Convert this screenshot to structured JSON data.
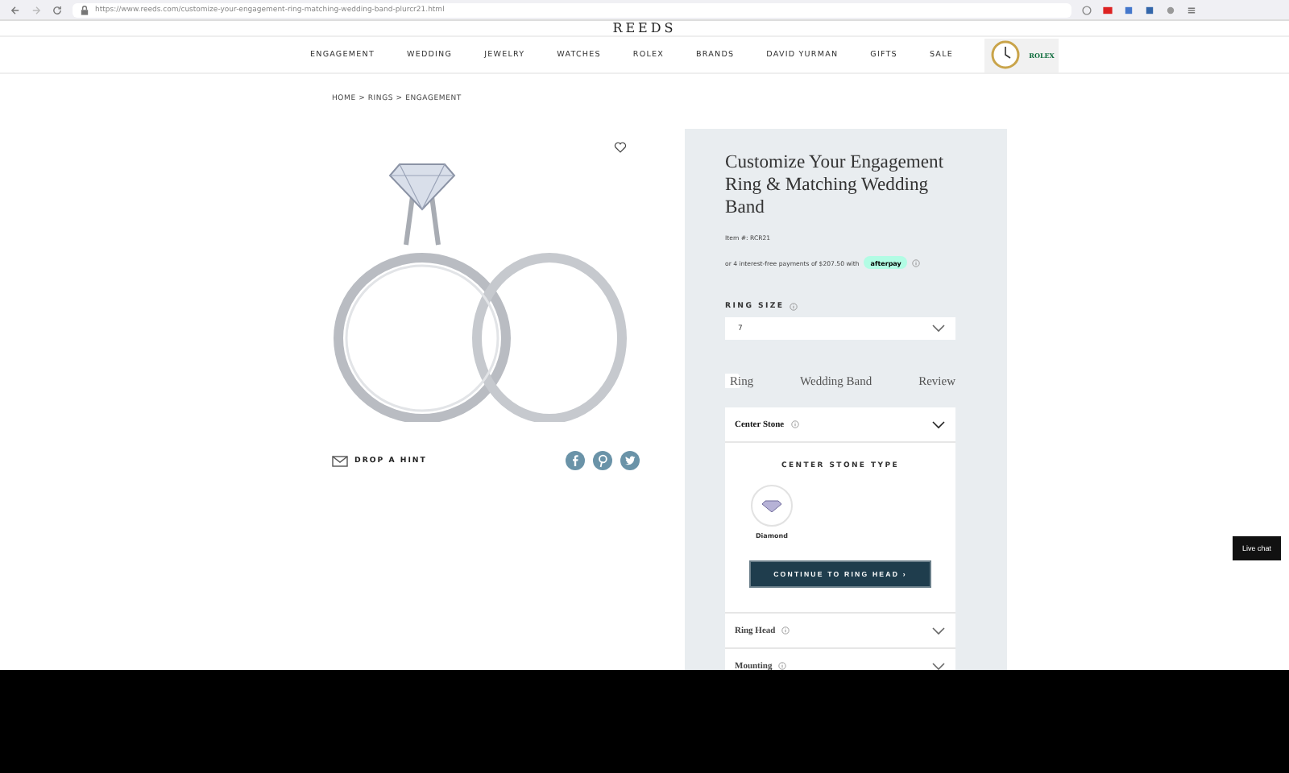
{
  "browser": {
    "url": "https://www.reeds.com/customize-your-engagement-ring-matching-wedding-band-plurcr21.html"
  },
  "logo": "REEDS",
  "nav": [
    "ENGAGEMENT",
    "WEDDING",
    "JEWELRY",
    "WATCHES",
    "ROLEX",
    "BRANDS",
    "DAVID YURMAN",
    "GIFTS",
    "SALE"
  ],
  "rolex_badge": {
    "label": "ROLEX"
  },
  "breadcrumb": "HOME > RINGS > ENGAGEMENT",
  "drop_hint": "DROP A HINT",
  "product": {
    "title": "Customize Your Engagement Ring & Matching Wedding Band",
    "item_number": "Item #: RCR21",
    "afterpay_text": "or 4 interest-free payments of $207.50 with",
    "afterpay_badge": "afterpay"
  },
  "ring_size": {
    "label": "RING SIZE",
    "value": "7"
  },
  "tabs": [
    {
      "label": "Ring",
      "selected": true
    },
    {
      "label": "Wedding Band",
      "selected": false
    },
    {
      "label": "Review",
      "selected": false
    }
  ],
  "sections": [
    {
      "title": "Center Stone",
      "expanded": true,
      "heading": "CENTER STONE TYPE",
      "options": [
        "Diamond"
      ],
      "button": "CONTINUE TO RING HEAD ›"
    },
    {
      "title": "Ring Head",
      "expanded": false
    },
    {
      "title": "Mounting",
      "expanded": false
    }
  ],
  "live_chat": "Live chat"
}
